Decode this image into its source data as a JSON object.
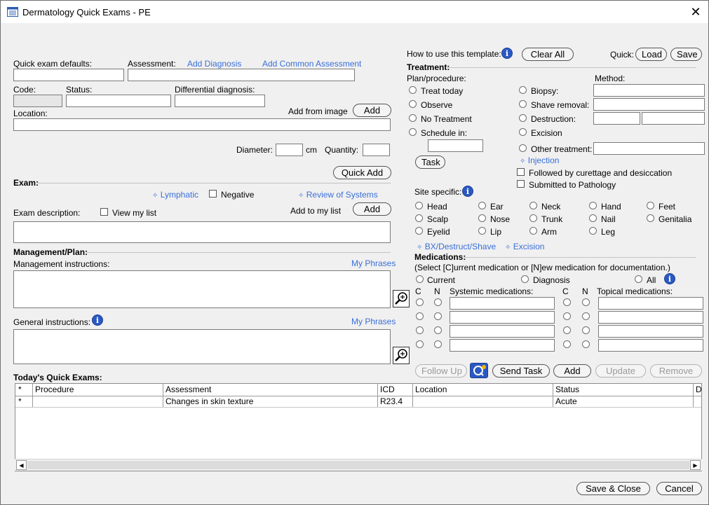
{
  "window": {
    "title": "Dermatology Quick Exams - PE"
  },
  "left": {
    "quick_exam_defaults_label": "Quick exam defaults:",
    "assessment_label": "Assessment:",
    "add_diagnosis": "Add Diagnosis",
    "add_common_assessment": "Add Common Assessment",
    "code_label": "Code:",
    "status_label": "Status:",
    "differential_label": "Differential diagnosis:",
    "location_label": "Location:",
    "add_from_image_label": "Add from image",
    "add_button": "Add",
    "diameter_label": "Diameter:",
    "cm_label": "cm",
    "quantity_label": "Quantity:",
    "quick_add_button": "Quick Add",
    "exam_section": "Exam:",
    "lymphatic": "Lymphatic",
    "negative_label": "Negative",
    "review_of_systems": "Review of Systems",
    "exam_description_label": "Exam description:",
    "view_my_list_label": "View my list",
    "add_to_my_list_label": "Add to my list",
    "add_button_2": "Add",
    "management_section": "Management/Plan:",
    "management_instructions_label": "Management instructions:",
    "my_phrases": "My Phrases",
    "general_instructions_label": "General instructions:",
    "my_phrases_2": "My Phrases"
  },
  "right": {
    "how_to_use": "How to use this template:",
    "clear_all": "Clear All",
    "quick_label": "Quick:",
    "load": "Load",
    "save": "Save",
    "treatment_section": "Treatment:",
    "plan_procedure_label": "Plan/procedure:",
    "method_label": "Method:",
    "plan_options": [
      "Treat today",
      "Observe",
      "No Treatment",
      "Schedule in:"
    ],
    "task_button": "Task",
    "method_options": [
      "Biopsy:",
      "Shave removal:",
      "Destruction:",
      "Excision",
      "Other treatment:"
    ],
    "injection": "Injection",
    "followed_by_curettage": "Followed by curettage and desiccation",
    "submitted_to_pathology": "Submitted to Pathology",
    "site_specific_label": "Site specific:",
    "sites": [
      [
        "Head",
        "Ear",
        "Neck",
        "Hand",
        "Feet"
      ],
      [
        "Scalp",
        "Nose",
        "Trunk",
        "Nail",
        "Genitalia"
      ],
      [
        "Eyelid",
        "Lip",
        "Arm",
        "Leg"
      ]
    ],
    "bx_destruct_shave": "BX/Destruct/Shave",
    "excision_link": "Excision",
    "medications_section": "Medications:",
    "medications_hint": "(Select [C]urrent medication or [N]ew medication for documentation.)",
    "current_label": "Current",
    "diagnosis_label": "Diagnosis",
    "all_label": "All",
    "c_label": "C",
    "n_label": "N",
    "systemic_label": "Systemic medications:",
    "topical_label": "Topical medications:",
    "follow_up": "Follow Up",
    "send_task": "Send Task",
    "add": "Add",
    "update": "Update",
    "remove": "Remove"
  },
  "todays_quick_exams": {
    "title": "Today's Quick Exams:",
    "columns": [
      "*",
      "Procedure",
      "Assessment",
      "ICD",
      "Location",
      "Status",
      "D"
    ],
    "rows": [
      [
        "*",
        "",
        "Changes in skin texture",
        "R23.4",
        "",
        "Acute"
      ]
    ]
  },
  "footer": {
    "save_close": "Save & Close",
    "cancel": "Cancel"
  }
}
